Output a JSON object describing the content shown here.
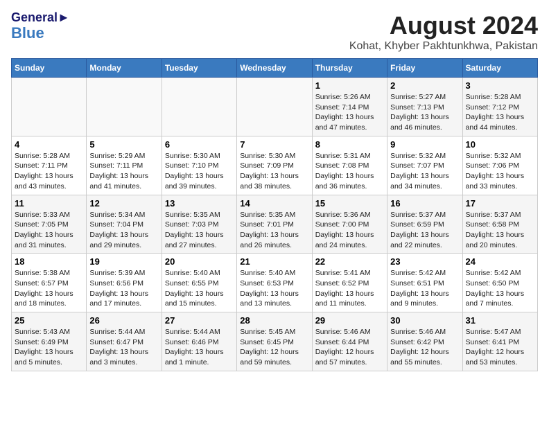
{
  "header": {
    "logo_general": "General",
    "logo_blue": "Blue",
    "title": "August 2024",
    "subtitle": "Kohat, Khyber Pakhtunkhwa, Pakistan"
  },
  "calendar": {
    "weekdays": [
      "Sunday",
      "Monday",
      "Tuesday",
      "Wednesday",
      "Thursday",
      "Friday",
      "Saturday"
    ],
    "weeks": [
      [
        {
          "day": "",
          "info": ""
        },
        {
          "day": "",
          "info": ""
        },
        {
          "day": "",
          "info": ""
        },
        {
          "day": "",
          "info": ""
        },
        {
          "day": "1",
          "info": "Sunrise: 5:26 AM\nSunset: 7:14 PM\nDaylight: 13 hours\nand 47 minutes."
        },
        {
          "day": "2",
          "info": "Sunrise: 5:27 AM\nSunset: 7:13 PM\nDaylight: 13 hours\nand 46 minutes."
        },
        {
          "day": "3",
          "info": "Sunrise: 5:28 AM\nSunset: 7:12 PM\nDaylight: 13 hours\nand 44 minutes."
        }
      ],
      [
        {
          "day": "4",
          "info": "Sunrise: 5:28 AM\nSunset: 7:11 PM\nDaylight: 13 hours\nand 43 minutes."
        },
        {
          "day": "5",
          "info": "Sunrise: 5:29 AM\nSunset: 7:11 PM\nDaylight: 13 hours\nand 41 minutes."
        },
        {
          "day": "6",
          "info": "Sunrise: 5:30 AM\nSunset: 7:10 PM\nDaylight: 13 hours\nand 39 minutes."
        },
        {
          "day": "7",
          "info": "Sunrise: 5:30 AM\nSunset: 7:09 PM\nDaylight: 13 hours\nand 38 minutes."
        },
        {
          "day": "8",
          "info": "Sunrise: 5:31 AM\nSunset: 7:08 PM\nDaylight: 13 hours\nand 36 minutes."
        },
        {
          "day": "9",
          "info": "Sunrise: 5:32 AM\nSunset: 7:07 PM\nDaylight: 13 hours\nand 34 minutes."
        },
        {
          "day": "10",
          "info": "Sunrise: 5:32 AM\nSunset: 7:06 PM\nDaylight: 13 hours\nand 33 minutes."
        }
      ],
      [
        {
          "day": "11",
          "info": "Sunrise: 5:33 AM\nSunset: 7:05 PM\nDaylight: 13 hours\nand 31 minutes."
        },
        {
          "day": "12",
          "info": "Sunrise: 5:34 AM\nSunset: 7:04 PM\nDaylight: 13 hours\nand 29 minutes."
        },
        {
          "day": "13",
          "info": "Sunrise: 5:35 AM\nSunset: 7:03 PM\nDaylight: 13 hours\nand 27 minutes."
        },
        {
          "day": "14",
          "info": "Sunrise: 5:35 AM\nSunset: 7:01 PM\nDaylight: 13 hours\nand 26 minutes."
        },
        {
          "day": "15",
          "info": "Sunrise: 5:36 AM\nSunset: 7:00 PM\nDaylight: 13 hours\nand 24 minutes."
        },
        {
          "day": "16",
          "info": "Sunrise: 5:37 AM\nSunset: 6:59 PM\nDaylight: 13 hours\nand 22 minutes."
        },
        {
          "day": "17",
          "info": "Sunrise: 5:37 AM\nSunset: 6:58 PM\nDaylight: 13 hours\nand 20 minutes."
        }
      ],
      [
        {
          "day": "18",
          "info": "Sunrise: 5:38 AM\nSunset: 6:57 PM\nDaylight: 13 hours\nand 18 minutes."
        },
        {
          "day": "19",
          "info": "Sunrise: 5:39 AM\nSunset: 6:56 PM\nDaylight: 13 hours\nand 17 minutes."
        },
        {
          "day": "20",
          "info": "Sunrise: 5:40 AM\nSunset: 6:55 PM\nDaylight: 13 hours\nand 15 minutes."
        },
        {
          "day": "21",
          "info": "Sunrise: 5:40 AM\nSunset: 6:53 PM\nDaylight: 13 hours\nand 13 minutes."
        },
        {
          "day": "22",
          "info": "Sunrise: 5:41 AM\nSunset: 6:52 PM\nDaylight: 13 hours\nand 11 minutes."
        },
        {
          "day": "23",
          "info": "Sunrise: 5:42 AM\nSunset: 6:51 PM\nDaylight: 13 hours\nand 9 minutes."
        },
        {
          "day": "24",
          "info": "Sunrise: 5:42 AM\nSunset: 6:50 PM\nDaylight: 13 hours\nand 7 minutes."
        }
      ],
      [
        {
          "day": "25",
          "info": "Sunrise: 5:43 AM\nSunset: 6:49 PM\nDaylight: 13 hours\nand 5 minutes."
        },
        {
          "day": "26",
          "info": "Sunrise: 5:44 AM\nSunset: 6:47 PM\nDaylight: 13 hours\nand 3 minutes."
        },
        {
          "day": "27",
          "info": "Sunrise: 5:44 AM\nSunset: 6:46 PM\nDaylight: 13 hours\nand 1 minute."
        },
        {
          "day": "28",
          "info": "Sunrise: 5:45 AM\nSunset: 6:45 PM\nDaylight: 12 hours\nand 59 minutes."
        },
        {
          "day": "29",
          "info": "Sunrise: 5:46 AM\nSunset: 6:44 PM\nDaylight: 12 hours\nand 57 minutes."
        },
        {
          "day": "30",
          "info": "Sunrise: 5:46 AM\nSunset: 6:42 PM\nDaylight: 12 hours\nand 55 minutes."
        },
        {
          "day": "31",
          "info": "Sunrise: 5:47 AM\nSunset: 6:41 PM\nDaylight: 12 hours\nand 53 minutes."
        }
      ]
    ]
  }
}
